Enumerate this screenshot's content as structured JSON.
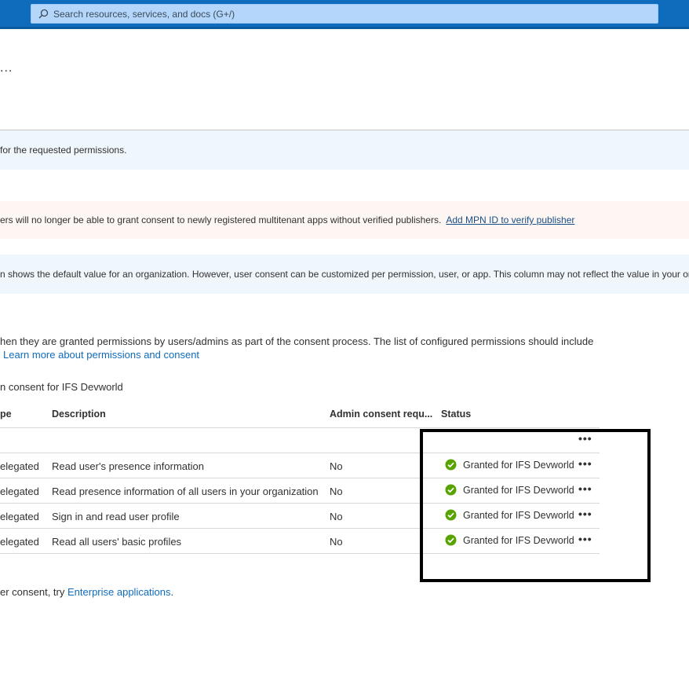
{
  "search": {
    "placeholder": "Search resources, services, and docs (G+/)"
  },
  "page": {
    "title_ellipsis": "..."
  },
  "banners": {
    "info1": "for the requested permissions.",
    "warning": {
      "text": "ers will no longer be able to grant consent to newly registered multitenant apps without verified publishers.",
      "link": "Add MPN ID to verify publisher"
    },
    "info2": "n shows the default value for an organization. However, user consent can be customized per permission, user, or app. This column may not reflect the value in your org"
  },
  "description": {
    "line1": "hen they are granted permissions by users/admins as part of the consent process. The list of configured permissions should include",
    "link": "Learn more about permissions and consent"
  },
  "grant_consent": {
    "label": "n consent for IFS Devworld"
  },
  "table": {
    "headers": {
      "type": "pe",
      "description": "Description",
      "admin_consent": "Admin consent requ...",
      "status": "Status"
    },
    "group_more": "•••",
    "rows": [
      {
        "type": "elegated",
        "description": "Read user's presence information",
        "admin": "No",
        "status": "Granted for IFS Devworld",
        "more": "•••"
      },
      {
        "type": "elegated",
        "description": "Read presence information of all users in your organization",
        "admin": "No",
        "status": "Granted for IFS Devworld",
        "more": "•••"
      },
      {
        "type": "elegated",
        "description": "Sign in and read user profile",
        "admin": "No",
        "status": "Granted for IFS Devworld",
        "more": "•••"
      },
      {
        "type": "elegated",
        "description": "Read all users' basic profiles",
        "admin": "No",
        "status": "Granted for IFS Devworld",
        "more": "•••"
      }
    ]
  },
  "footer": {
    "text": "er consent, try",
    "link": "Enterprise applications",
    "suffix": "."
  },
  "colors": {
    "topbar": "#0f6cbd",
    "success": "#57a300",
    "link": "#0f6cbd",
    "highlight": "#000000"
  }
}
